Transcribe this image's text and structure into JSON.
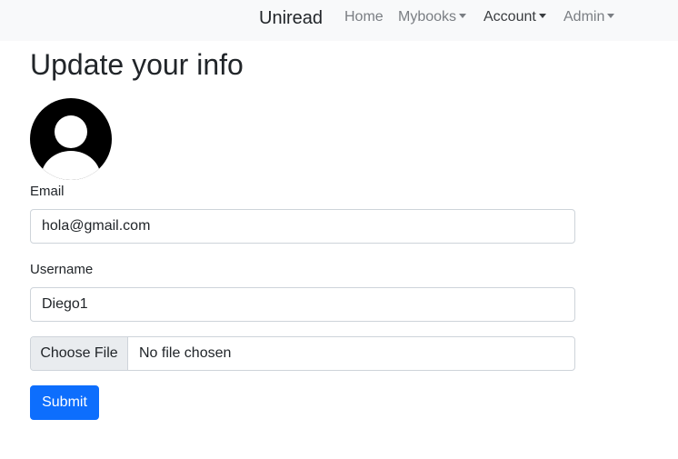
{
  "navbar": {
    "brand": "Uniread",
    "items": [
      {
        "label": "Home",
        "has_dropdown": false
      },
      {
        "label": "Mybooks",
        "has_dropdown": true
      },
      {
        "label": "Account",
        "has_dropdown": true,
        "active": true
      },
      {
        "label": "Admin",
        "has_dropdown": true
      }
    ]
  },
  "page": {
    "title": "Update your info",
    "avatar_icon": "user-avatar-icon"
  },
  "form": {
    "email_label": "Email",
    "email_value": "hola@gmail.com",
    "username_label": "Username",
    "username_value": "Diego1",
    "file_button_label": "Choose File",
    "file_status": "No file chosen",
    "submit_label": "Submit"
  },
  "colors": {
    "primary": "#0d6efd",
    "navbar_bg": "#f8f9fa",
    "border": "#ced4da"
  }
}
